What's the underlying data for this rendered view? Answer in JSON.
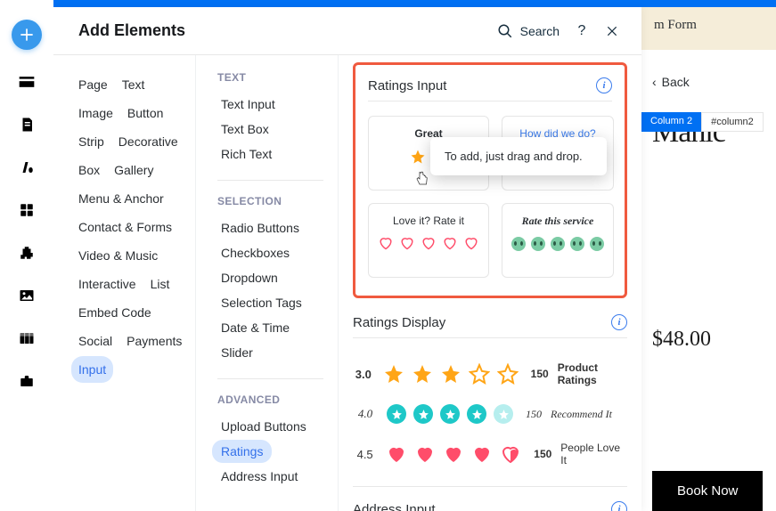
{
  "header": {
    "title": "Add Elements",
    "search_label": "Search"
  },
  "col1": {
    "items": [
      {
        "label": "Page"
      },
      {
        "label": "Text"
      },
      {
        "label": "Image"
      },
      {
        "label": "Button"
      },
      {
        "label": "Strip"
      },
      {
        "label": "Decorative"
      },
      {
        "label": "Box"
      },
      {
        "label": "Gallery"
      },
      {
        "label": "Menu & Anchor"
      },
      {
        "label": "Contact & Forms"
      },
      {
        "label": "Video & Music"
      },
      {
        "label": "Interactive"
      },
      {
        "label": "List"
      },
      {
        "label": "Embed Code"
      },
      {
        "label": "Social"
      },
      {
        "label": "Payments"
      },
      {
        "label": "Input",
        "active": true
      }
    ]
  },
  "col2": {
    "groups": [
      {
        "label": "TEXT",
        "items": [
          "Text Input",
          "Text Box",
          "Rich Text"
        ]
      },
      {
        "label": "SELECTION",
        "items": [
          "Radio Buttons",
          "Checkboxes",
          "Dropdown",
          "Selection Tags",
          "Date & Time",
          "Slider"
        ]
      },
      {
        "label": "ADVANCED",
        "items": [
          "Upload Buttons",
          "Ratings",
          "Address Input"
        ],
        "active_index": 1
      }
    ]
  },
  "col3": {
    "ratings_input": {
      "title": "Ratings Input",
      "tooltip": "To add, just drag and drop.",
      "cards": [
        {
          "label": "Great"
        },
        {
          "label": "How did we do?"
        },
        {
          "label": "Love it? Rate it"
        },
        {
          "label": "Rate this service"
        }
      ]
    },
    "ratings_display": {
      "title": "Ratings Display",
      "rows": [
        {
          "score": "3.0",
          "count": "150",
          "label": "Product Ratings"
        },
        {
          "score": "4.0",
          "count": "150",
          "label": "Recommend It"
        },
        {
          "score": "4.5",
          "count": "150",
          "label": "People Love It"
        }
      ]
    },
    "address_input": {
      "title": "Address Input"
    }
  },
  "bg": {
    "form_header": "m Form",
    "column_tag": "Column 2",
    "column_id": "#column2",
    "back": "Back",
    "product": "Manic",
    "price": "$48.00",
    "book": "Book Now"
  }
}
